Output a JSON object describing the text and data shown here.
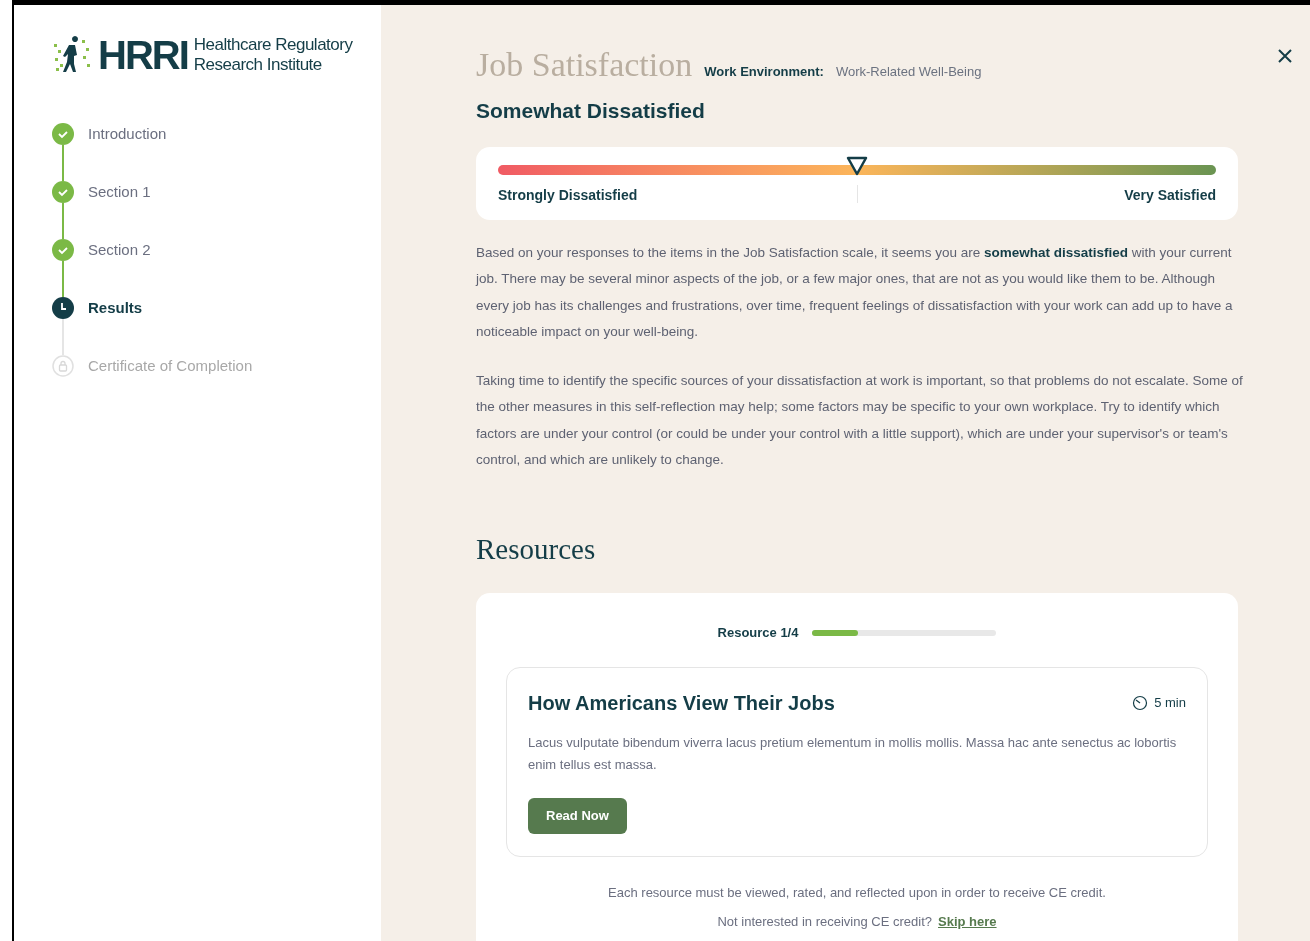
{
  "logo": {
    "mark": "HRRI",
    "name_line_1": "Healthcare Regulatory",
    "name_line_2": "Research Institute"
  },
  "steps": [
    {
      "label": "Introduction",
      "kind": "done"
    },
    {
      "label": "Section 1",
      "kind": "done"
    },
    {
      "label": "Section 2",
      "kind": "done"
    },
    {
      "label": "Results",
      "kind": "current"
    },
    {
      "label": "Certificate of Completion",
      "kind": "locked"
    }
  ],
  "header": {
    "title": "Job Satisfaction",
    "category_label": "Work Environment:",
    "category_value": "Work-Related Well-Being"
  },
  "result": {
    "heading": "Somewhat Dissatisfied",
    "scale": {
      "level": 0.5,
      "min_label": "Strongly Dissatisfied",
      "max_label": "Very Satisfied"
    }
  },
  "paragraphs": [
    "Based on your responses to the items in the Job Satisfaction scale, it seems you are **somewhat dissatisfied** with your current job. There may be several minor aspects of the job, or a few major ones, that are not as you would like them to be. Although every job has its challenges and frustrations, over time, frequent feelings of dissatisfaction with your work can add up to have a noticeable impact on your well-being.",
    "Taking time to identify the specific sources of your dissatisfaction at work is important, so that problems do not escalate. Some of the other measures in this self-reflection may help; some factors may be specific to your own workplace. Try to identify which factors are under your control (or could be under your control with a little support), which are under your supervisor's or team's control, and which are unlikely to change."
  ],
  "resources": {
    "heading": "Resources",
    "progress_label": "Resource 1/4",
    "progress": {
      "level": 0.25
    },
    "card": {
      "title": "How Americans View Their Jobs",
      "duration": "5 min",
      "description": "Lacus vulputate bibendum viverra lacus pretium elementum in mollis mollis. Massa hac ante senectus ac lobortis enim tellus est massa.",
      "button": "Read Now"
    },
    "note": "Each resource must be viewed, rated, and reflected upon in order to receive CE credit.",
    "skip_prompt": "Not interested in receiving CE credit?",
    "skip_link": "Skip here"
  }
}
